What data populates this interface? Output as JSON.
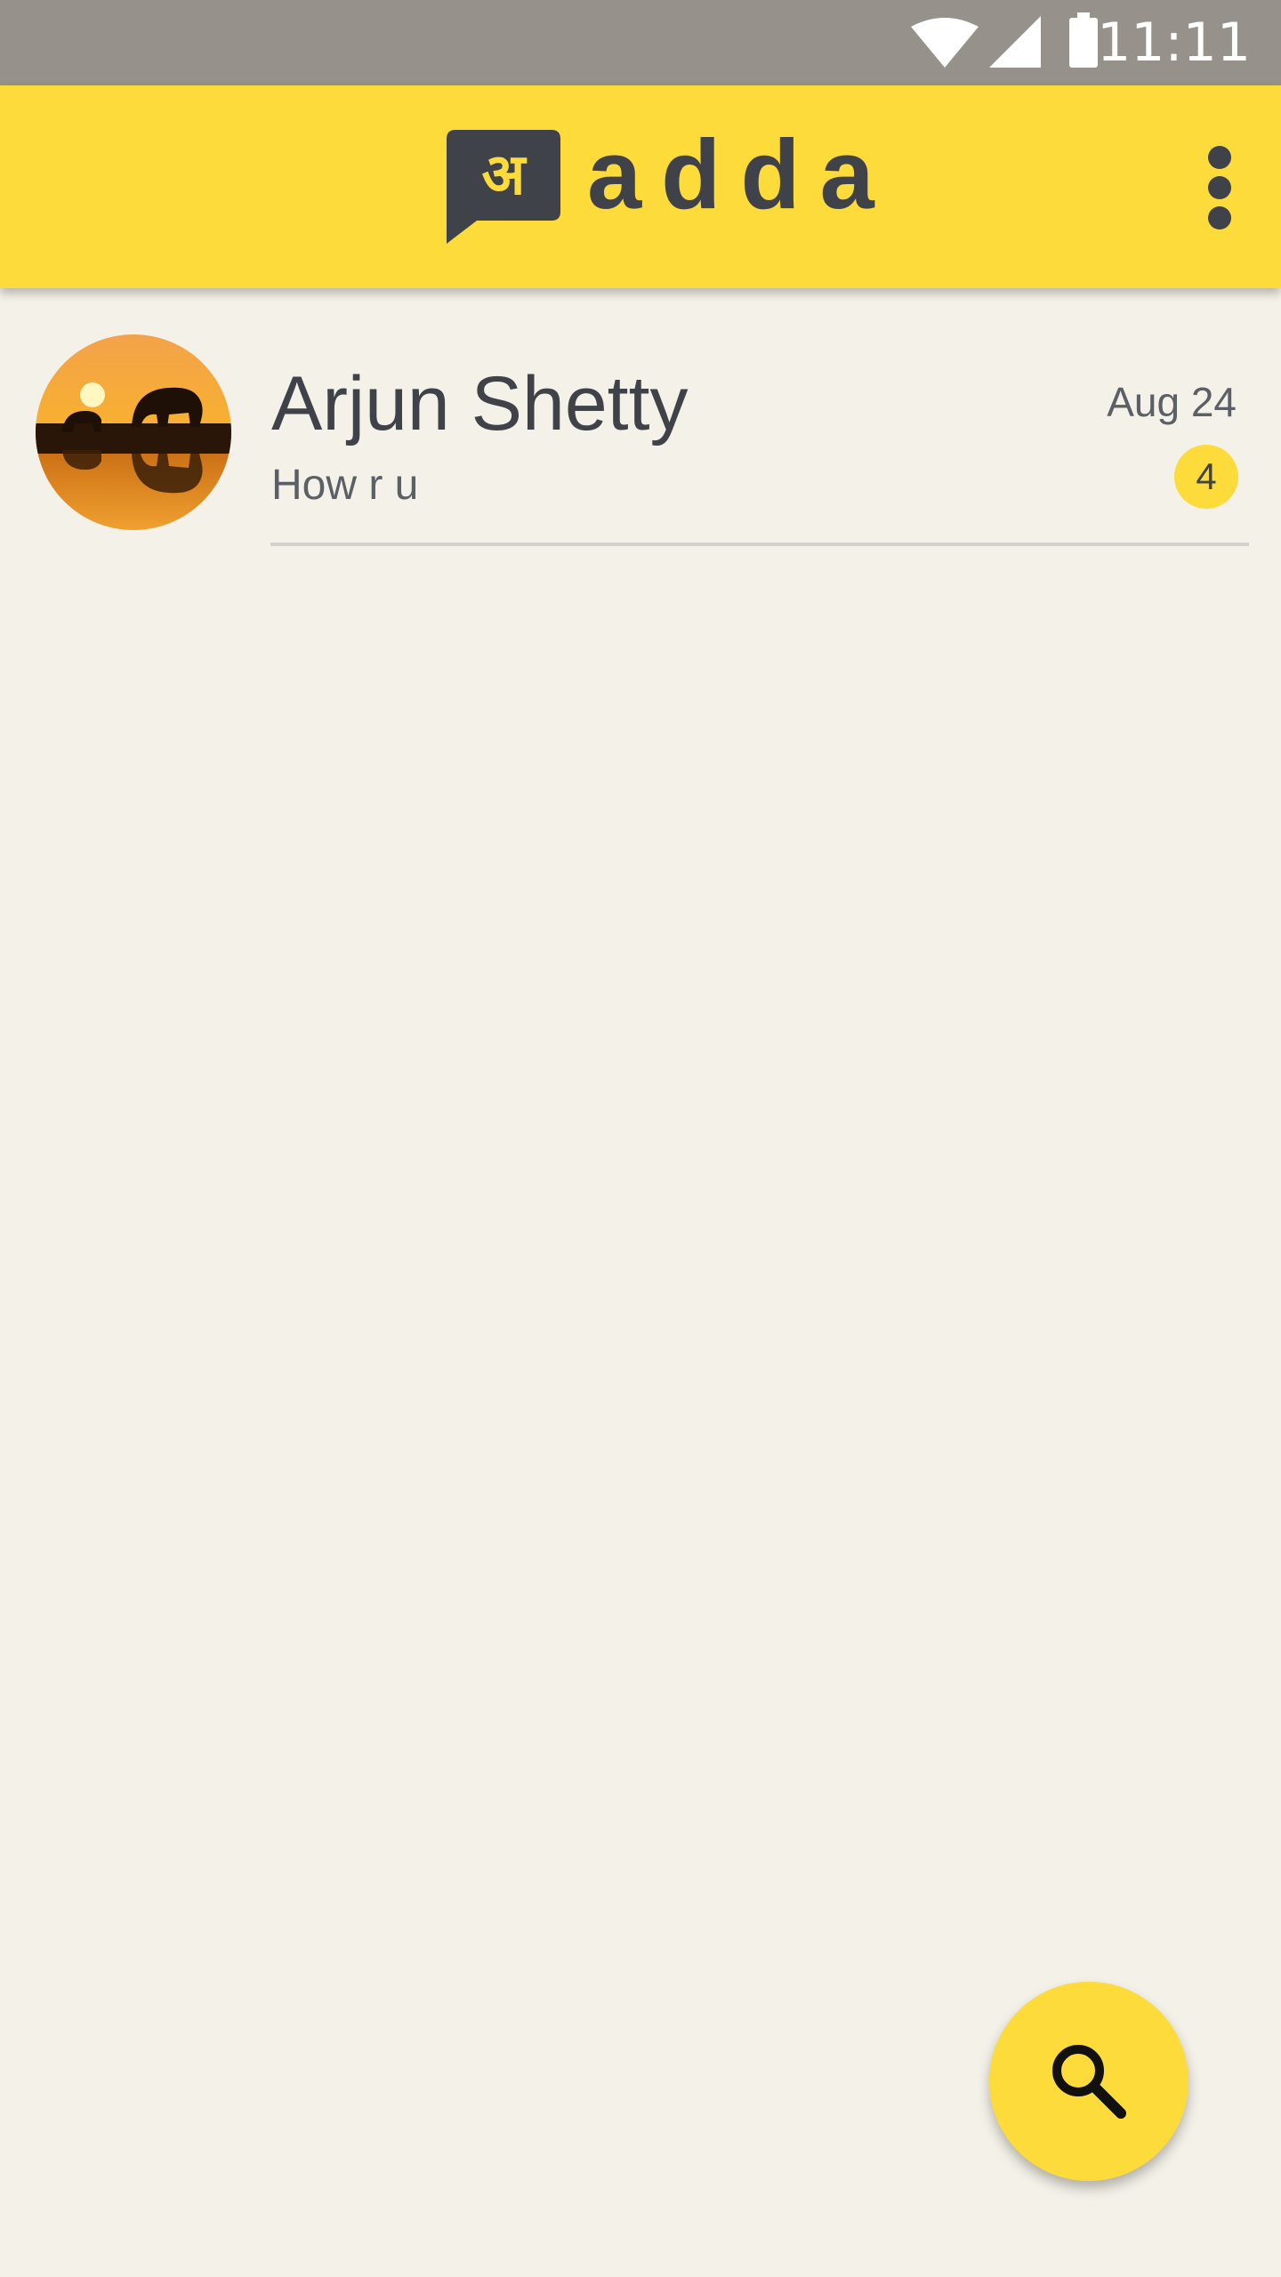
{
  "status_bar": {
    "time": "11:11",
    "icons": [
      "wifi-icon",
      "cellular-signal-icon",
      "battery-icon"
    ],
    "background": "#96928b"
  },
  "app_bar": {
    "title": "adda",
    "logo_glyph": "अ",
    "logo_icon": "chat-bubble-logo-icon",
    "menu_icon": "more-vert-icon",
    "background": "#fddb3a"
  },
  "chats": [
    {
      "name": "Arjun Shetty",
      "preview": "How r u",
      "date": "Aug 24",
      "unread_count": "4",
      "avatar_icon": "elephant-sunset-avatar"
    }
  ],
  "fab": {
    "icon": "search-icon",
    "background": "#fddb3a"
  },
  "colors": {
    "page_background": "#f4f2e8",
    "text_dark": "#3f4349",
    "accent": "#fddb3a"
  }
}
